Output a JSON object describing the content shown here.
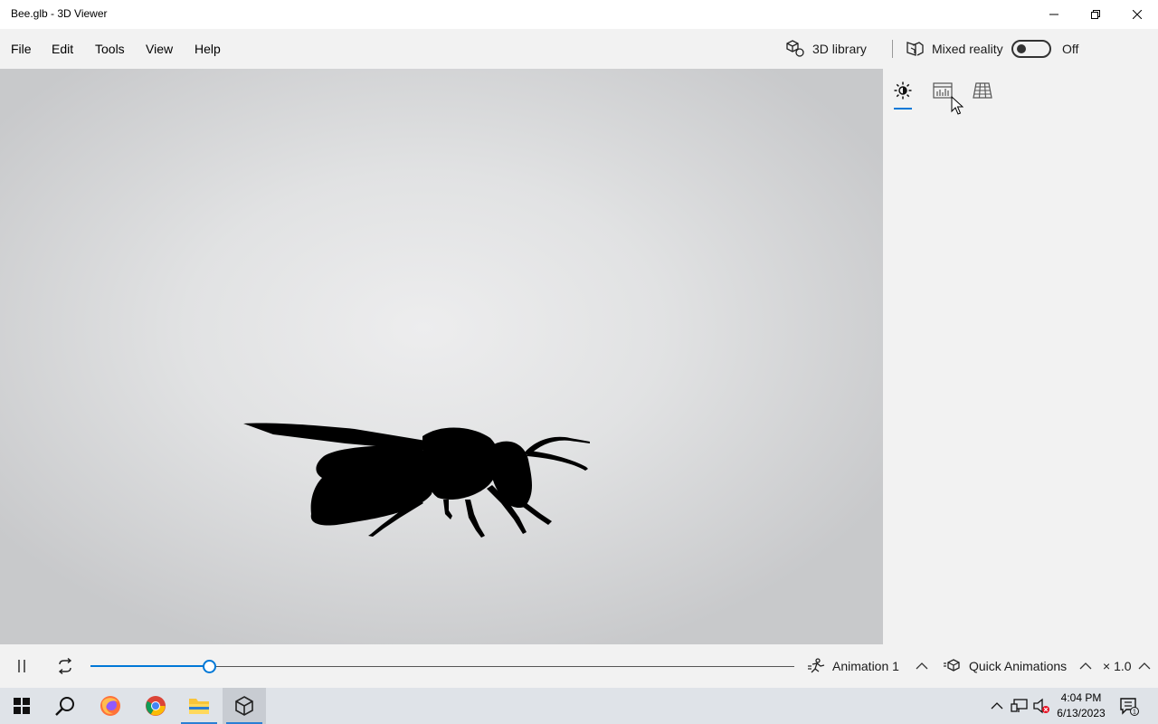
{
  "window": {
    "title": "Bee.glb - 3D Viewer"
  },
  "menu": {
    "file": "File",
    "edit": "Edit",
    "tools": "Tools",
    "view": "View",
    "help": "Help"
  },
  "toolbar": {
    "library_label": "3D library",
    "mixed_reality_label": "Mixed reality",
    "toggle_state": "Off"
  },
  "panel": {
    "tabs": [
      "lighting",
      "stats",
      "grid"
    ],
    "active_tab": "lighting"
  },
  "animation": {
    "progress": 0.17,
    "animation_label": "Animation 1",
    "quick_label": "Quick Animations",
    "speed_label": "× 1.0"
  },
  "taskbar": {
    "apps": [
      "start",
      "search",
      "firefox",
      "chrome",
      "file-explorer",
      "3d-viewer"
    ],
    "active_app": "3d-viewer",
    "time": "4:04 PM",
    "date": "6/13/2023",
    "notification_count": "1"
  },
  "colors": {
    "accent": "#0078d7",
    "viewport_center": "#ededee",
    "viewport_edge": "#c8c9cb",
    "panel_bg": "#f2f2f2",
    "taskbar_bg": "#dfe3e8"
  }
}
